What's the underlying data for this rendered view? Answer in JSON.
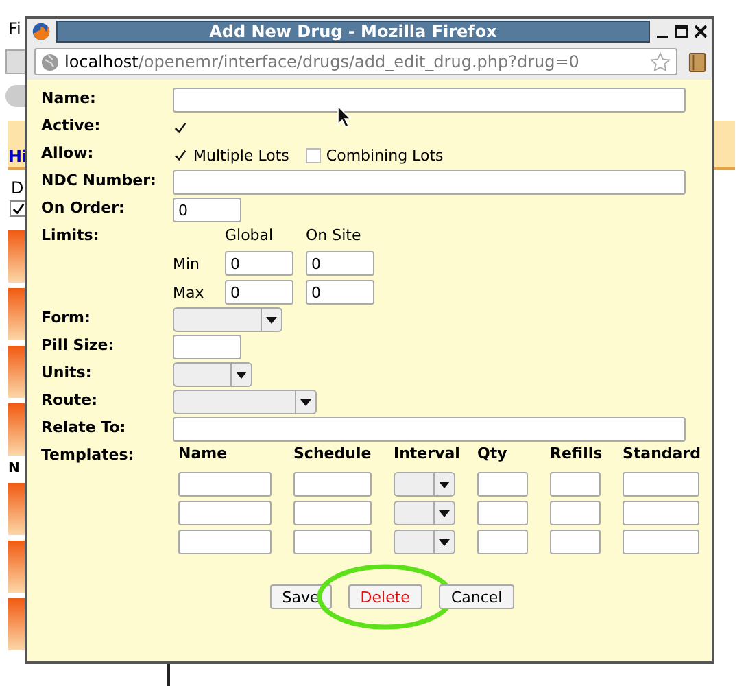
{
  "background": {
    "menu": "Fi",
    "link": "Hi",
    "column_label": "D",
    "checkbox": {
      "checked": true
    },
    "icon_label": "N"
  },
  "window": {
    "title": "Add New Drug - Mozilla Firefox"
  },
  "address_bar": {
    "host": "localhost",
    "path": "/openemr/interface/drugs/add_edit_drug.php?drug=0"
  },
  "form": {
    "rows": [
      {
        "kind": "line",
        "label": "Name:"
      },
      {
        "kind": "checkbox",
        "label": "Active:",
        "checked": true
      },
      {
        "kind": "checks",
        "label": "Allow:",
        "options": [
          {
            "label": "Multiple Lots",
            "checked": true
          },
          {
            "label": "Combining Lots",
            "checked": false
          }
        ]
      },
      {
        "kind": "line",
        "label": "NDC Number:"
      },
      {
        "kind": "box",
        "label": "On Order:",
        "value": "0"
      },
      {
        "kind": "limits",
        "label": "Limits:",
        "columns": [
          "Global",
          "On Site"
        ],
        "rows": [
          {
            "label": "Min",
            "values": [
              "0",
              "0"
            ]
          },
          {
            "label": "Max",
            "values": [
              "0",
              "0"
            ]
          }
        ]
      },
      {
        "kind": "select",
        "label": "Form:"
      },
      {
        "kind": "box",
        "label": "Pill Size:"
      },
      {
        "kind": "select",
        "label": "Units:"
      },
      {
        "kind": "select",
        "label": "Route:"
      },
      {
        "kind": "line",
        "label": "Relate To:"
      },
      {
        "kind": "templates",
        "label": "Templates:",
        "columns": [
          {
            "label": "Name",
            "kind": "text"
          },
          {
            "label": "Schedule",
            "kind": "text"
          },
          {
            "label": "Interval",
            "kind": "select"
          },
          {
            "label": "Qty",
            "kind": "text"
          },
          {
            "label": "Refills",
            "kind": "text"
          },
          {
            "label": "Standard",
            "kind": "text"
          }
        ],
        "rows": [
          {
            "kind": "blank"
          },
          {
            "kind": "blank"
          },
          {
            "kind": "blank"
          }
        ]
      }
    ]
  },
  "buttons": [
    {
      "label": "Save",
      "kind": "normal",
      "highlighted": false
    },
    {
      "label": "Delete",
      "kind": "danger",
      "highlighted": true
    },
    {
      "label": "Cancel",
      "kind": "normal",
      "highlighted": false
    }
  ]
}
